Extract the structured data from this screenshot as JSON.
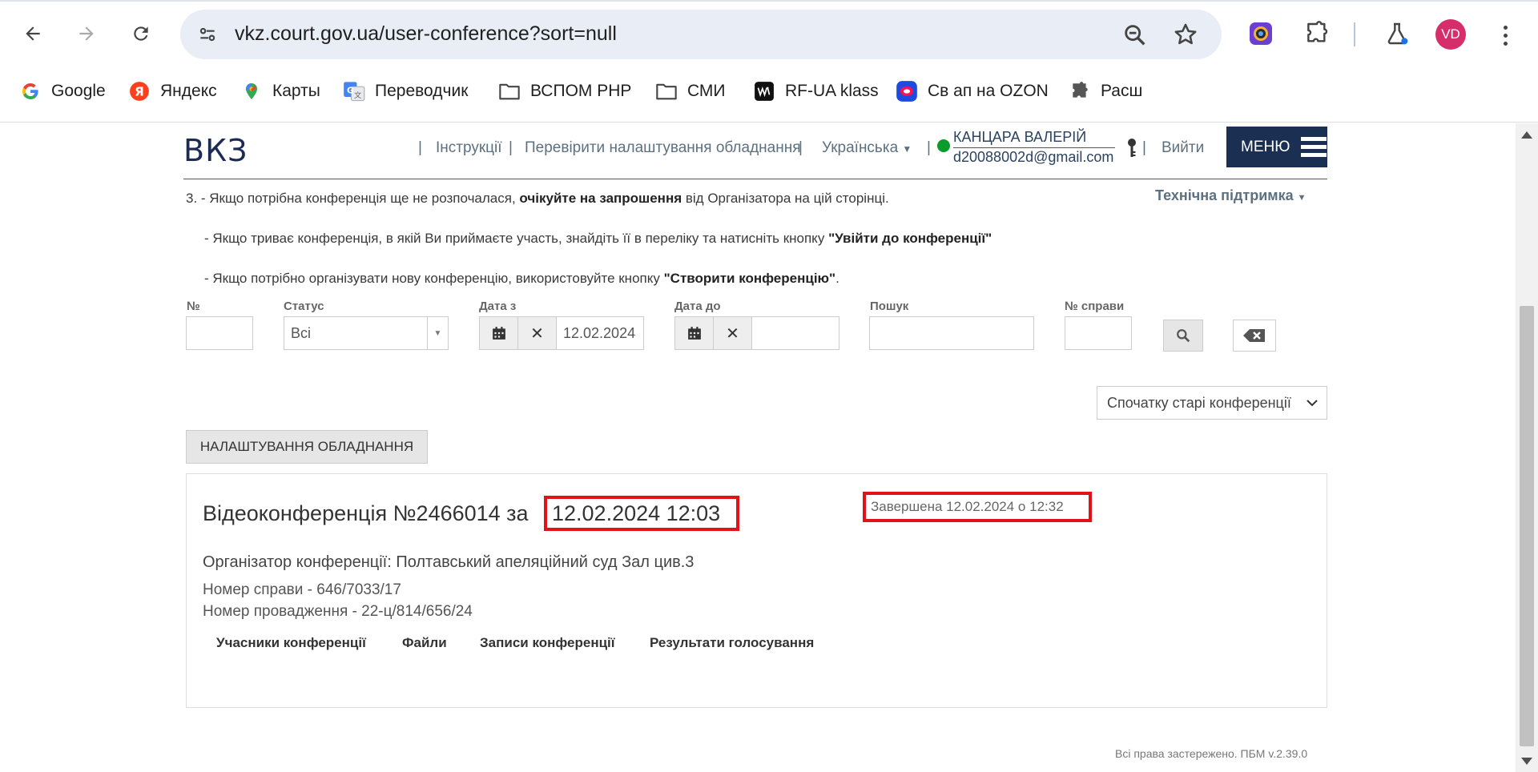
{
  "browser": {
    "url": "vkz.court.gov.ua/user-conference?sort=null",
    "profile_initials": "VD",
    "profile_color": "#d62e6a",
    "bookmarks": [
      {
        "label": "Google",
        "icon": "google-icon"
      },
      {
        "label": "Яндекс",
        "icon": "yandex-icon"
      },
      {
        "label": "Карты",
        "icon": "maps-pin-icon"
      },
      {
        "label": "Переводчик",
        "icon": "translate-icon"
      },
      {
        "label": "ВСПОМ PHP",
        "icon": "folder-icon"
      },
      {
        "label": "СМИ",
        "icon": "folder-icon"
      },
      {
        "label": "RF-UA klass",
        "icon": "wb-icon"
      },
      {
        "label": "Св ап на OZON",
        "icon": "ozon-icon"
      },
      {
        "label": "Расш",
        "icon": "puzzle-icon"
      }
    ]
  },
  "header": {
    "logo": "ВКЗ",
    "nav": {
      "instructions": "Інструкції",
      "check_equipment": "Перевірити налаштування обладнання",
      "language": "Українська"
    },
    "user": {
      "name": "КАНЦАРА ВАЛЕРІЙ",
      "email": "d20088002d@gmail.com",
      "status_color": "#0a9b2a"
    },
    "logout": "Вийти",
    "menu": "МЕНЮ",
    "brand_color": "#1b2f52"
  },
  "instructions": {
    "line1_prefix": "3.  - Якщо потрібна конференція ще не розпочалася,",
    "line1_bold": "очікуйте на запрошення",
    "line1_suffix": "від Організатора на цій сторінці.",
    "line2_prefix": "- Якщо триває конференція, в якій Ви приймаєте участь, знайдіть її в переліку та натисніть кнопку",
    "line2_bold": "\"Увійти до конференції\"",
    "line3_prefix": "- Якщо потрібно організувати нову конференцію, використовуйте кнопку",
    "line3_bold": "\"Створити конференцію\"",
    "line3_suffix": ".",
    "support": "Технічна підтримка"
  },
  "filters": {
    "number_label": "№",
    "number_value": "",
    "status_label": "Статус",
    "status_value": "Всі",
    "date_from_label": "Дата з",
    "date_from_value": "12.02.2024",
    "date_to_label": "Дата до",
    "date_to_value": "",
    "search_label": "Пошук",
    "search_value": "",
    "case_label": "№ справи",
    "case_value": ""
  },
  "sort": {
    "value": "Спочатку старі конференції"
  },
  "equipment_button": "НАЛАШТУВАННЯ ОБЛАДНАННЯ",
  "conference": {
    "title": "Відеоконференція №2466014 за",
    "datetime": "12.02.2024 12:03",
    "status": "Завершена 12.02.2024 о 12:32",
    "organizer": "Організатор конференції: Полтавський апеляційний суд Зал цив.3",
    "case_number": "Номер справи - 646/7033/17",
    "proceeding_number": "Номер провадження - 22-ц/814/656/24",
    "tabs": [
      "Учасники конференції",
      "Файли",
      "Записи конференції",
      "Результати голосування"
    ],
    "highlight_color": "#e0121a"
  },
  "footer": "Всі права застережено. ПБМ v.2.39.0"
}
